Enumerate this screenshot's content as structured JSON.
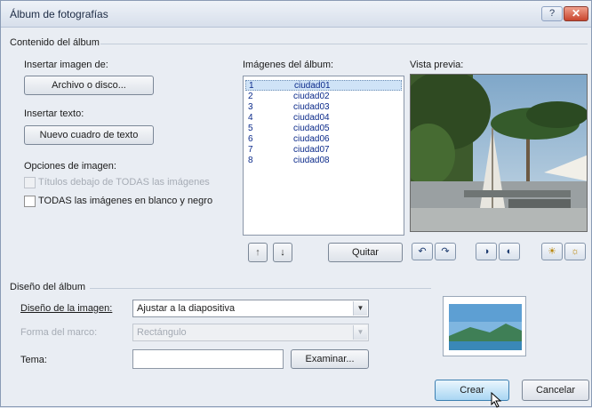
{
  "window": {
    "title": "Álbum de fotografías",
    "help_glyph": "?",
    "close_glyph": "✕"
  },
  "contenido": {
    "group_label": "Contenido del álbum",
    "insertar_imagen_label": "Insertar imagen de:",
    "archivo_button": "Archivo o disco...",
    "insertar_texto_label": "Insertar texto:",
    "nuevo_cuadro_button": "Nuevo cuadro de texto",
    "opciones_label": "Opciones de imagen:",
    "titulos_checkbox": "Títulos debajo de TODAS las imágenes",
    "blanco_negro_checkbox": "TODAS las imágenes en blanco y negro"
  },
  "imagenes": {
    "label": "Imágenes del álbum:",
    "items": [
      {
        "num": "1",
        "name": "ciudad01"
      },
      {
        "num": "2",
        "name": "ciudad02"
      },
      {
        "num": "3",
        "name": "ciudad03"
      },
      {
        "num": "4",
        "name": "ciudad04"
      },
      {
        "num": "5",
        "name": "ciudad05"
      },
      {
        "num": "6",
        "name": "ciudad06"
      },
      {
        "num": "7",
        "name": "ciudad07"
      },
      {
        "num": "8",
        "name": "ciudad08"
      }
    ],
    "move_up_glyph": "↑",
    "move_down_glyph": "↓",
    "quitar_button": "Quitar"
  },
  "vista_previa": {
    "label": "Vista previa:",
    "tools": [
      {
        "name": "rotate-left-icon",
        "glyph": "↶"
      },
      {
        "name": "rotate-right-icon",
        "glyph": "↷"
      },
      {
        "name": "contrast-up-icon",
        "glyph": "◑"
      },
      {
        "name": "contrast-down-icon",
        "glyph": "◐"
      },
      {
        "name": "brightness-up-icon",
        "glyph": "☀"
      },
      {
        "name": "brightness-down-icon",
        "glyph": "☼"
      }
    ]
  },
  "diseno": {
    "group_label": "Diseño del álbum",
    "diseno_imagen_label": "Diseño de la imagen:",
    "diseno_imagen_value": "Ajustar a la diapositiva",
    "forma_marco_label": "Forma del marco:",
    "forma_marco_value": "Rectángulo",
    "tema_label": "Tema:",
    "tema_value": "",
    "examinar_button": "Examinar...",
    "combo_arrow": "▼"
  },
  "footer": {
    "crear_button": "Crear",
    "cancelar_button": "Cancelar"
  },
  "colors": {
    "accent": "#3c7fb1",
    "selection": "#cfe3f7",
    "list_text": "#0b2a8a"
  }
}
